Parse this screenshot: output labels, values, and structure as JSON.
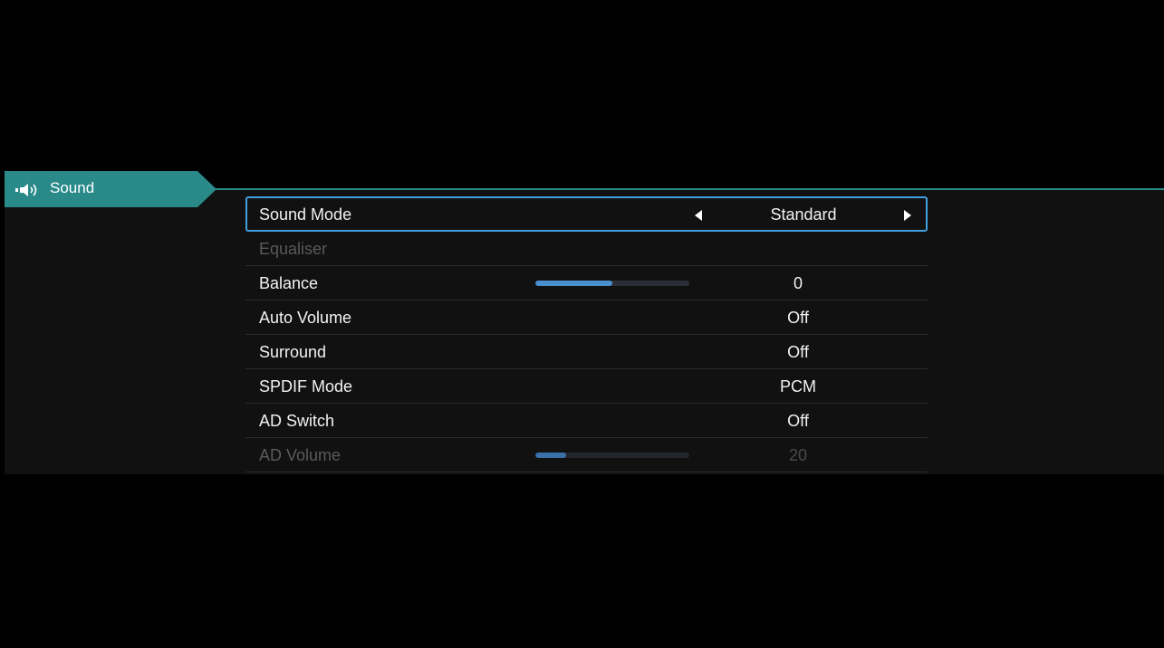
{
  "category": {
    "icon": "speaker-icon",
    "label": "Sound"
  },
  "colors": {
    "accent": "#2a8a8a",
    "focus_border": "#3fa0e0",
    "slider_fill": "#4a8fd0"
  },
  "menu": {
    "items": [
      {
        "label": "Sound Mode",
        "value": "Standard",
        "focused": true,
        "disabled": false,
        "has_arrows": true
      },
      {
        "label": "Equaliser",
        "value": "",
        "focused": false,
        "disabled": true
      },
      {
        "label": "Balance",
        "value": "0",
        "focused": false,
        "disabled": false,
        "slider_level": 0.5
      },
      {
        "label": "Auto Volume",
        "value": "Off",
        "focused": false,
        "disabled": false
      },
      {
        "label": "Surround",
        "value": "Off",
        "focused": false,
        "disabled": false
      },
      {
        "label": "SPDIF Mode",
        "value": "PCM",
        "focused": false,
        "disabled": false
      },
      {
        "label": "AD Switch",
        "value": "Off",
        "focused": false,
        "disabled": false
      },
      {
        "label": "AD Volume",
        "value": "20",
        "focused": false,
        "disabled": true,
        "slider_level": 0.2
      }
    ]
  }
}
